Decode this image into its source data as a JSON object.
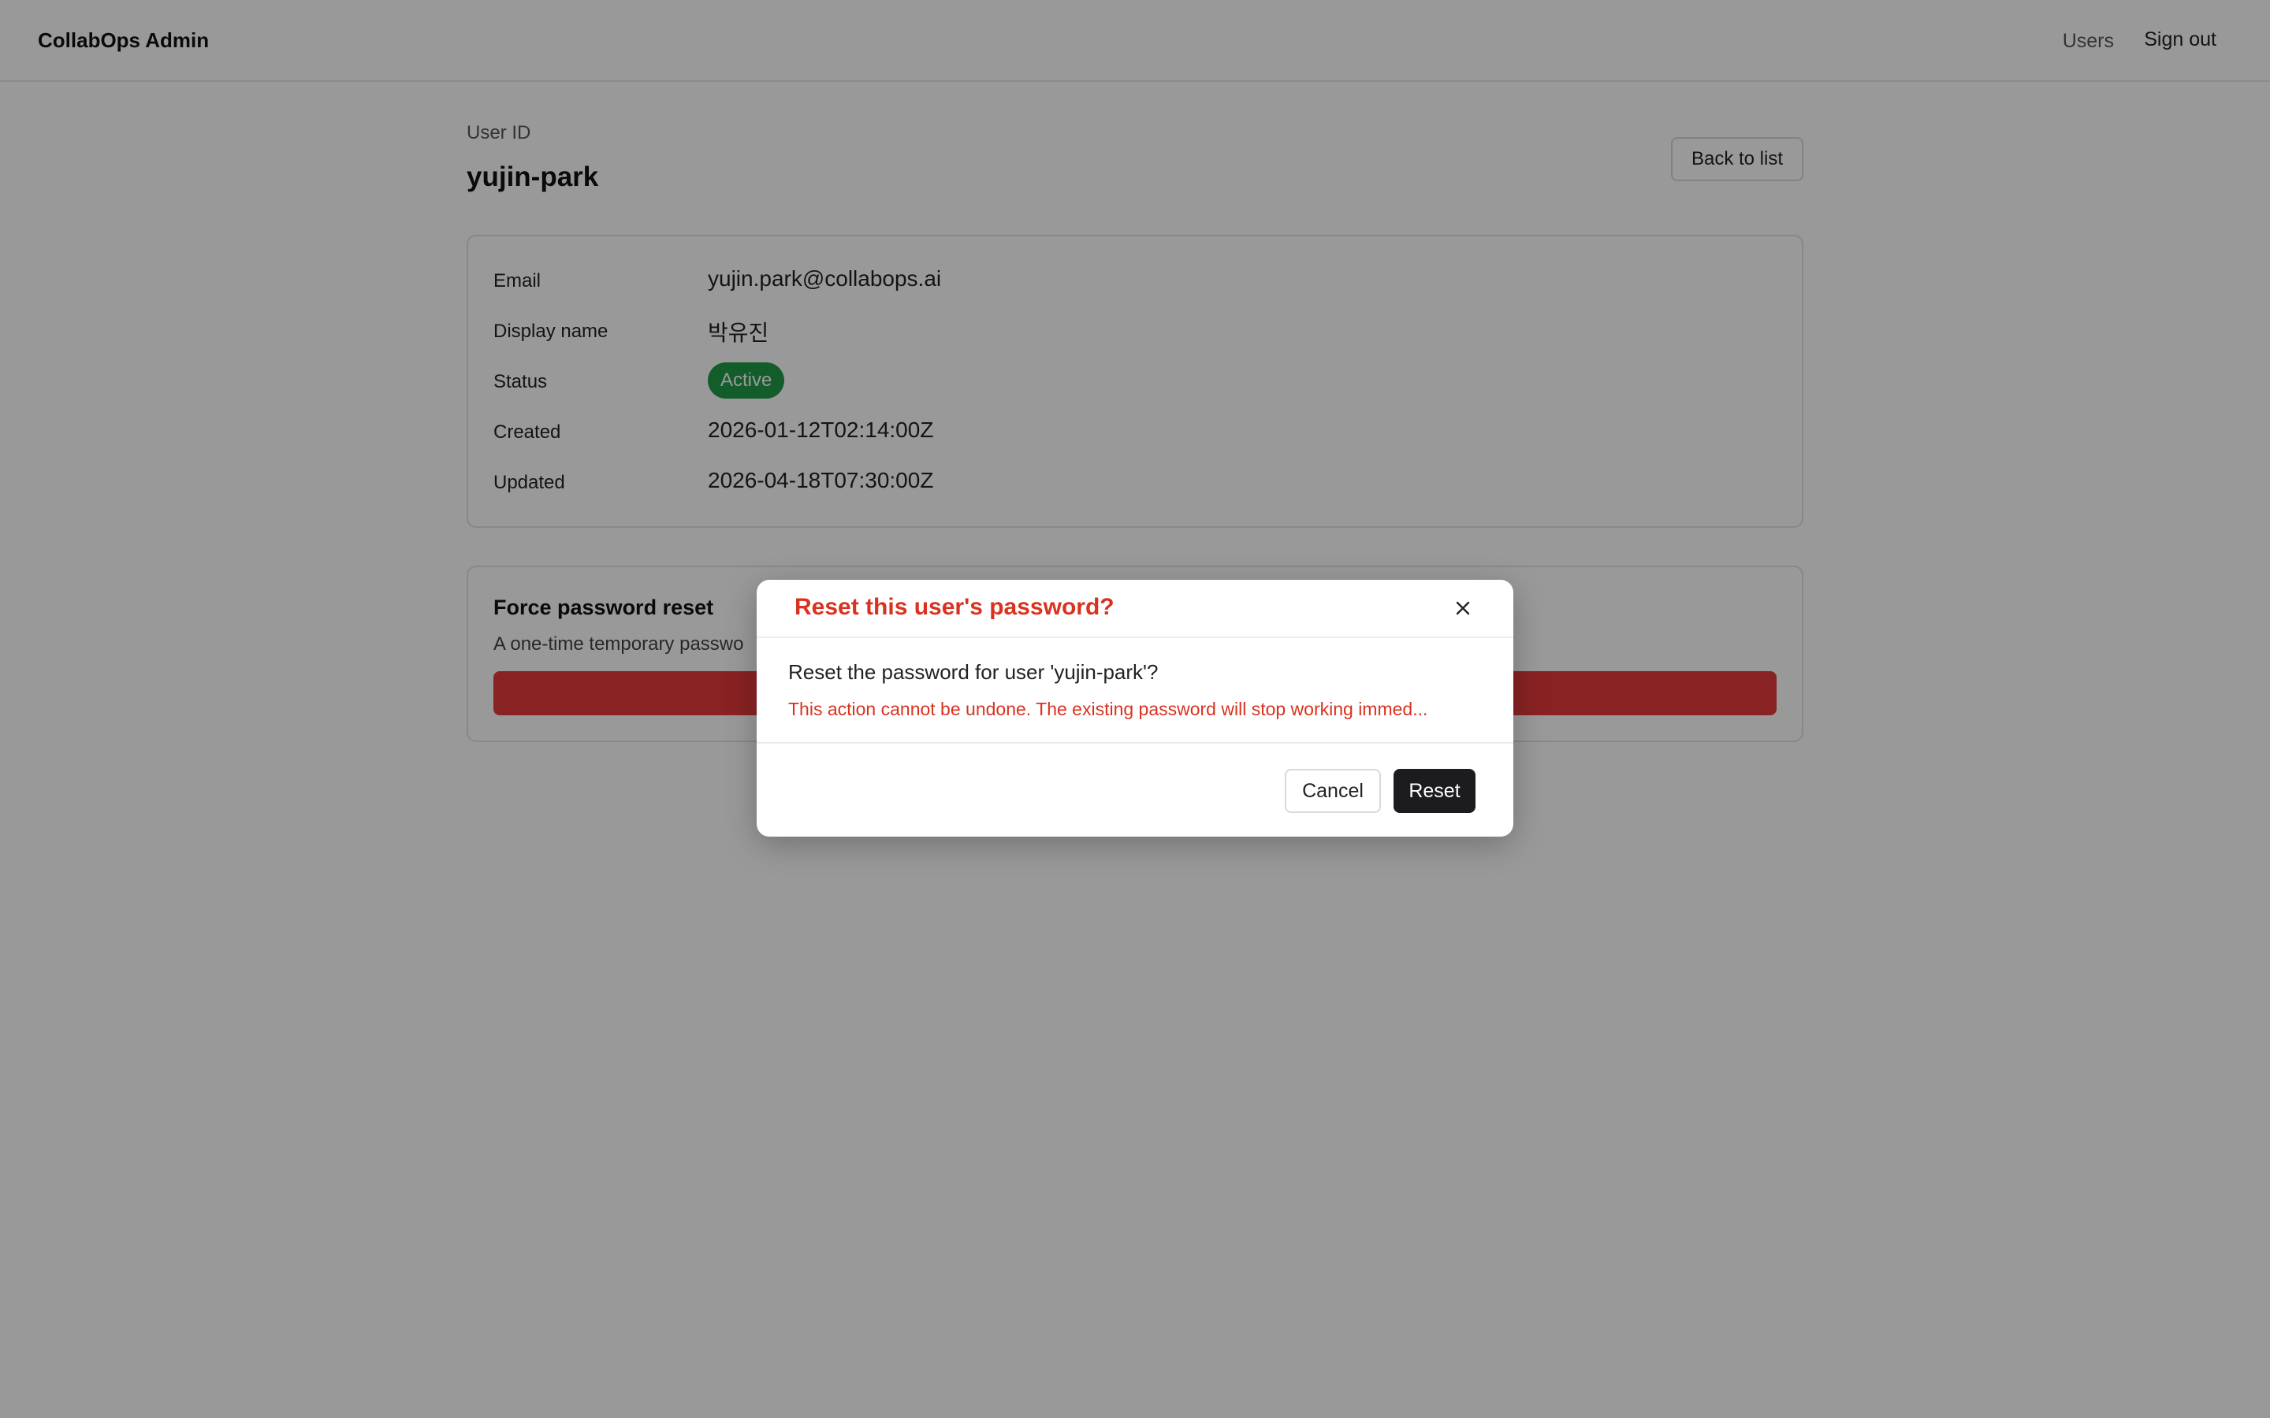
{
  "app": {
    "brand": "CollabOps Admin"
  },
  "nav": {
    "users": "Users",
    "sign_out": "Sign out"
  },
  "header": {
    "userid_label": "User ID",
    "username": "yujin-park",
    "back_label": "Back to list"
  },
  "details": {
    "email_label": "Email",
    "email": "yujin.park@collabops.ai",
    "display_name_label": "Display name",
    "display_name": "박유진",
    "status_label": "Status",
    "status": "Active",
    "status_color": "#1f9b47",
    "created_label": "Created",
    "created": "2026-01-12T02:14:00Z",
    "updated_label": "Updated",
    "updated": "2026-04-18T07:30:00Z"
  },
  "reset_section": {
    "title": "Force password reset",
    "description": "A one-time temporary passwo"
  },
  "modal": {
    "title": "Reset this user's password?",
    "message": "Reset the password for user 'yujin-park'?",
    "warning": "This action cannot be undone. The existing password will stop working immed...",
    "cancel_label": "Cancel",
    "confirm_label": "Reset",
    "accent_color": "#d9321f"
  }
}
